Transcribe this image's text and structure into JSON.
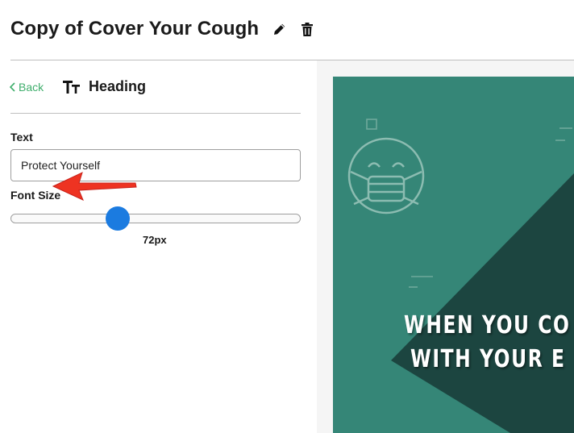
{
  "header": {
    "title": "Copy of Cover Your Cough",
    "icons": {
      "edit": "pencil-icon",
      "delete": "trash-icon"
    }
  },
  "panel": {
    "back_label": "Back",
    "title": "Heading",
    "text_label": "Text",
    "text_value": "Protect Yourself",
    "font_size_label": "Font Size",
    "font_size_value": "72px",
    "font_size_fraction": 0.37
  },
  "preview": {
    "headline_line1": "WHEN YOU CO",
    "headline_line2": "WITH YOUR E",
    "background_color": "#358677",
    "dark_color": "#1c4540"
  },
  "colors": {
    "accent": "#3fae6c",
    "slider_thumb": "#1b7be0",
    "annotation": "#ee3322"
  }
}
